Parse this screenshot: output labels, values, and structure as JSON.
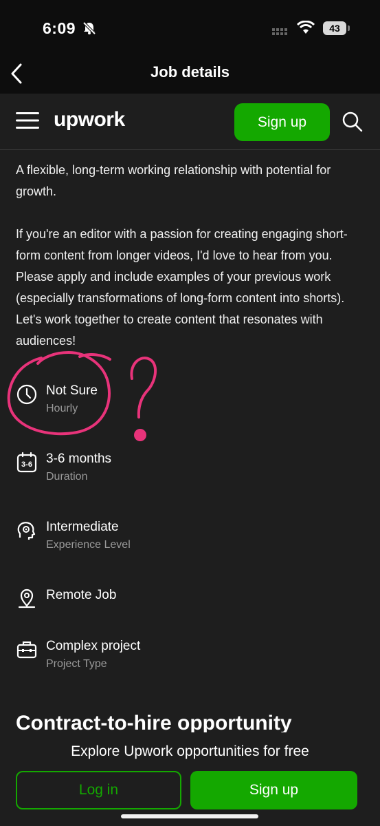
{
  "status_bar": {
    "time": "6:09",
    "battery": "43"
  },
  "nav": {
    "title": "Job details"
  },
  "header": {
    "logo": "upwork",
    "signup_label": "Sign up"
  },
  "description": {
    "paragraph1": "A flexible, long-term working relationship with potential for growth.",
    "paragraph2": "If you're an editor with a passion for creating engaging short-form content from longer videos, I'd love to hear from you. Please apply and include examples of your previous work (especially transformations of long-form content into shorts). Let's work together to create content that resonates with audiences!"
  },
  "details": [
    {
      "icon": "clock-icon",
      "title": "Not Sure",
      "subtitle": "Hourly"
    },
    {
      "icon": "calendar-icon",
      "icon_text": "3-6",
      "title": "3-6 months",
      "subtitle": "Duration"
    },
    {
      "icon": "gear-head-icon",
      "title": "Intermediate",
      "subtitle": "Experience Level"
    },
    {
      "icon": "location-pin-icon",
      "title": "Remote Job"
    },
    {
      "icon": "briefcase-icon",
      "title": "Complex project",
      "subtitle": "Project Type"
    }
  ],
  "next_section_heading": "Contract-to-hire opportunity",
  "bottom": {
    "explore_text": "Explore Upwork opportunities for free",
    "login_label": "Log in",
    "signup_label": "Sign up"
  },
  "colors": {
    "brand_green": "#14a800",
    "annotation_pink": "#e8337a",
    "background": "#1e1e1e"
  }
}
